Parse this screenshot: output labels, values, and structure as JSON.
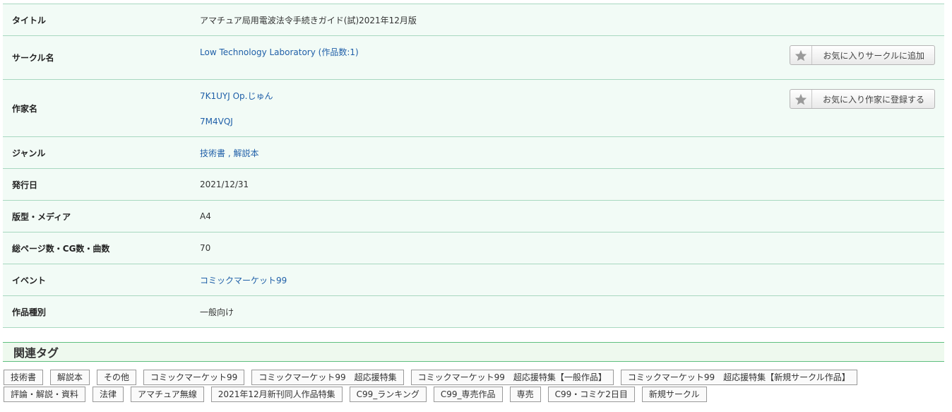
{
  "rows": {
    "title": {
      "label": "タイトル",
      "value": "アマチュア局用電波法令手続きガイド(試)2021年12月版"
    },
    "circle": {
      "label": "サークル名",
      "value": "Low Technology Laboratory (作品数:1)",
      "button": "お気に入りサークルに追加"
    },
    "author": {
      "label": "作家名",
      "values": [
        "7K1UYJ Op.じゅん",
        "7M4VQJ"
      ],
      "button": "お気に入り作家に登録する"
    },
    "genre": {
      "label": "ジャンル",
      "value": "技術書 , 解説本"
    },
    "date": {
      "label": "発行日",
      "value": "2021/12/31"
    },
    "format": {
      "label": "版型・メディア",
      "value": "A4"
    },
    "pages": {
      "label": "総ページ数・CG数・曲数",
      "value": "70"
    },
    "event": {
      "label": "イベント",
      "value": "コミックマーケット99"
    },
    "type": {
      "label": "作品種別",
      "value": "一般向け"
    }
  },
  "tags_section": {
    "title": "関連タグ",
    "line1": [
      "技術書",
      "解説本",
      "その他",
      "コミックマーケット99",
      "コミックマーケット99　超応援特集",
      "コミックマーケット99　超応援特集【一般作品】",
      "コミックマーケット99　超応援特集【新規サークル作品】"
    ],
    "line2": [
      "評論・解説・資料",
      "法律",
      "アマチュア無線",
      "2021年12月新刊同人作品特集",
      "C99_ランキング",
      "C99_専売作品",
      "専売",
      "C99・コミケ2日目",
      "新規サークル"
    ]
  },
  "icons": {
    "favorite": "star-icon"
  },
  "colors": {
    "accent_border": "#a8d8c0",
    "row_bg": "#f2fbf6",
    "link": "#1f5fa8",
    "header_border": "#5fbf7f"
  }
}
